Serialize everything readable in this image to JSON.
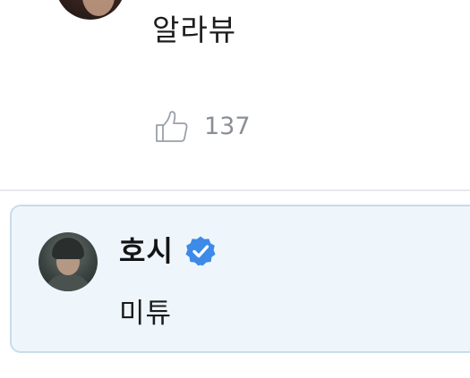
{
  "previous_comment": {
    "text": "알라뷰",
    "like_icon": "thumbs-up-outline-icon",
    "like_count": "137"
  },
  "highlighted_comment": {
    "author": "호시",
    "verified_icon": "verified-badge-icon",
    "text": "미튜",
    "colors": {
      "card_background": "#eef6fc",
      "card_border": "#c8dcea",
      "verified_badge": "#3d8ae8"
    }
  }
}
